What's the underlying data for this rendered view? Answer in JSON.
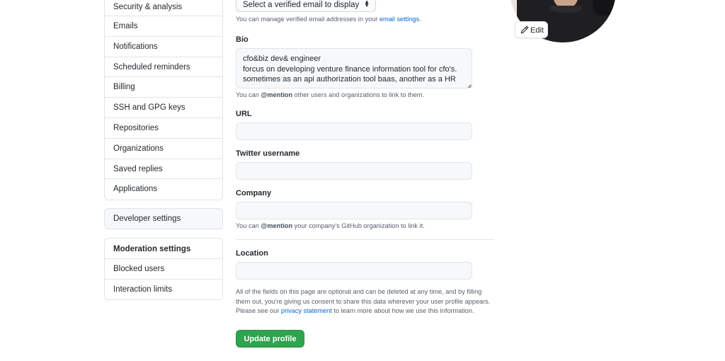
{
  "sidebar": {
    "items": [
      {
        "label": "Security & analysis"
      },
      {
        "label": "Emails"
      },
      {
        "label": "Notifications"
      },
      {
        "label": "Scheduled reminders"
      },
      {
        "label": "Billing"
      },
      {
        "label": "SSH and GPG keys"
      },
      {
        "label": "Repositories"
      },
      {
        "label": "Organizations"
      },
      {
        "label": "Saved replies"
      },
      {
        "label": "Applications"
      }
    ],
    "developer_settings": "Developer settings",
    "moderation": {
      "heading": "Moderation settings",
      "items": [
        {
          "label": "Blocked users"
        },
        {
          "label": "Interaction limits"
        }
      ]
    }
  },
  "email": {
    "select_value": "Select a verified email to display",
    "note_prefix": "You can manage verified email addresses in your ",
    "note_link": "email settings",
    "note_suffix": "."
  },
  "bio": {
    "label": "Bio",
    "lines": [
      "cfo&biz dev& engineer",
      "forcus on developing venture finance information tool for cfo's.",
      "sometimes as an api authorization tool baas, another as a HR"
    ],
    "note_prefix": "You can ",
    "note_mention": "@mention",
    "note_suffix": " other users and organizations to link to them."
  },
  "url": {
    "label": "URL",
    "value": ""
  },
  "twitter": {
    "label": "Twitter username",
    "value": ""
  },
  "company": {
    "label": "Company",
    "value": "",
    "note_prefix": "You can ",
    "note_mention": "@mention",
    "note_suffix": " your company's GitHub organization to link it."
  },
  "location": {
    "label": "Location",
    "value": ""
  },
  "disclaimer": {
    "text_before": "All of the fields on this page are optional and can be deleted at any time, and by filling them out, you're giving us consent to share this data wherever your user profile appears. Please see our ",
    "link": "privacy statement",
    "text_after": " to learn more about how we use this information."
  },
  "buttons": {
    "update_profile": "Update profile",
    "edit_avatar": "Edit"
  },
  "colors": {
    "primary_button": "#2ea44f",
    "link": "#0366d6",
    "border": "#e1e4e8"
  }
}
